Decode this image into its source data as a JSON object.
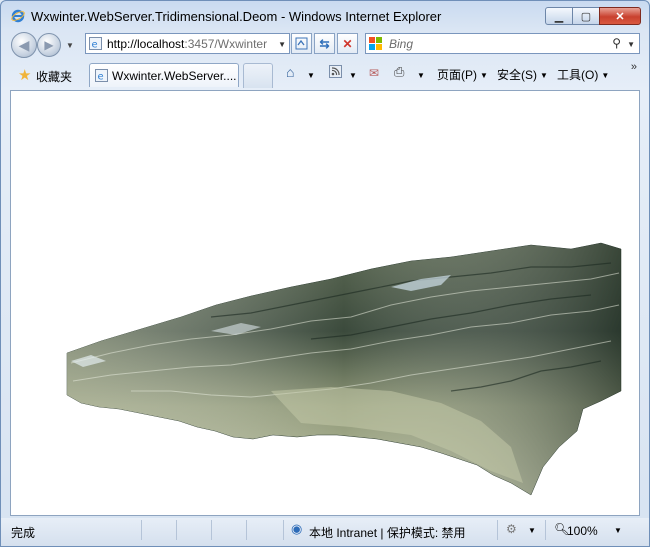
{
  "window": {
    "title": "Wxwinter.WebServer.Tridimensional.Deom - Windows Internet Explorer"
  },
  "address": {
    "host": "http://localhost",
    "rest": ":3457/Wxwinter"
  },
  "search": {
    "placeholder": "Bing"
  },
  "favorites": {
    "label": "收藏夹",
    "tab_title": "Wxwinter.WebServer...."
  },
  "commands": {
    "page": "页面(P)",
    "safety": "安全(S)",
    "tools": "工具(O)"
  },
  "status": {
    "text": "完成",
    "zone": "本地 Intranet | 保护模式: 禁用",
    "zoom": "100%"
  },
  "colors": {
    "accent": "#2c6bb8",
    "close_button": "#c9412f",
    "terrain_dark": "#1f2f26",
    "terrain_light": "#b9c0a0"
  },
  "icons": {
    "back": "back-arrow-icon",
    "forward": "forward-arrow-icon",
    "refresh": "refresh-icon",
    "stop": "stop-icon",
    "home": "home-icon",
    "feeds": "rss-icon",
    "mail": "mail-icon",
    "print": "printer-icon"
  }
}
